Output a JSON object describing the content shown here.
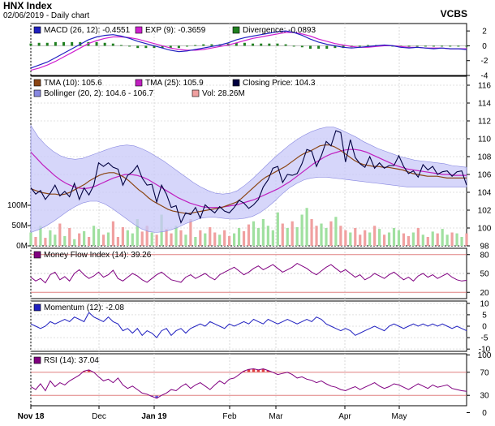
{
  "header": {
    "title": "HNX Index",
    "subtitle": "02/06/2019 - Daily chart",
    "brand": "VCBS"
  },
  "colors": {
    "panel_bg": "#ffffff",
    "band": "#c8c8f8",
    "band_edge": "#8888e0",
    "close": "#000040",
    "tma10": "#8b4513",
    "tma25": "#c020c0",
    "macd": "#2020c0",
    "signal": "#d020d0",
    "divergence": "#208020",
    "mfi": "#800080",
    "momentum": "#2020c0",
    "rsi": "#800080",
    "vol_up": "#a0e0a0",
    "vol_down": "#f0a0a0",
    "overbought": "#e04040",
    "oversold": "#6060e0"
  },
  "chart_data": {
    "type": "line",
    "x_axis": {
      "labels": [
        "Nov 18",
        "Dec",
        "Jan 19",
        "Feb",
        "Mar",
        "Apr",
        "May"
      ],
      "bold": [
        "Nov 18",
        "Jan 19"
      ]
    },
    "panels": [
      {
        "id": "macd",
        "legend": [
          {
            "label": "MACD (26, 12): -0.4551",
            "color": "#2020c0"
          },
          {
            "label": "EXP (9): -0.3659",
            "color": "#d020d0"
          },
          {
            "label": "Divergence: -0.0893",
            "color": "#208020"
          }
        ],
        "ylim": [
          -4,
          3
        ],
        "ticks": [
          "2",
          "0",
          "-2",
          "-4"
        ],
        "macd": [
          -3.0,
          -2.6,
          -2.2,
          -1.6,
          -1.0,
          -0.4,
          0.2,
          0.8,
          1.2,
          1.4,
          1.5,
          1.3,
          1.0,
          0.6,
          0.3,
          0.0,
          -0.3,
          -0.6,
          -0.8,
          -0.7,
          -0.5,
          -0.3,
          -0.1,
          0.1,
          0.4,
          0.8,
          1.1,
          1.3,
          1.5,
          1.7,
          1.9,
          2.0,
          1.8,
          1.4,
          0.9,
          0.5,
          0.2,
          0.0,
          -0.2,
          -0.3,
          -0.2,
          -0.1,
          0.0,
          0.1,
          0.0,
          -0.2,
          -0.3,
          -0.2,
          -0.3,
          -0.4,
          -0.3,
          -0.4,
          -0.4,
          -0.5
        ],
        "signal": [
          -3.3,
          -3.0,
          -2.6,
          -2.1,
          -1.5,
          -0.9,
          -0.3,
          0.3,
          0.7,
          1.0,
          1.2,
          1.2,
          1.1,
          0.9,
          0.6,
          0.3,
          0.0,
          -0.3,
          -0.5,
          -0.6,
          -0.6,
          -0.5,
          -0.3,
          -0.1,
          0.1,
          0.4,
          0.7,
          1.0,
          1.2,
          1.4,
          1.6,
          1.8,
          1.8,
          1.6,
          1.3,
          0.9,
          0.6,
          0.3,
          0.1,
          -0.1,
          -0.2,
          -0.2,
          -0.1,
          0.0,
          0.0,
          -0.1,
          -0.2,
          -0.2,
          -0.3,
          -0.3,
          -0.3,
          -0.4,
          -0.4,
          -0.4
        ],
        "divergence": [
          0.3,
          0.4,
          0.4,
          0.5,
          0.5,
          0.5,
          0.5,
          0.5,
          0.5,
          0.4,
          0.3,
          0.1,
          -0.1,
          -0.3,
          -0.3,
          -0.3,
          -0.3,
          -0.3,
          -0.3,
          -0.1,
          0.1,
          0.2,
          0.2,
          0.2,
          0.3,
          0.4,
          0.4,
          0.3,
          0.3,
          0.3,
          0.3,
          0.2,
          0.0,
          -0.2,
          -0.4,
          -0.4,
          -0.4,
          -0.3,
          -0.3,
          -0.2,
          0.0,
          0.1,
          0.1,
          0.1,
          0.0,
          -0.1,
          -0.1,
          0.0,
          0.0,
          -0.1,
          0.0,
          0.0,
          0.0,
          -0.1
        ]
      },
      {
        "id": "price",
        "legend": [
          {
            "label": "TMA (10): 105.6",
            "color": "#8b4513"
          },
          {
            "label": "TMA (25): 105.9",
            "color": "#c020c0"
          },
          {
            "label": "Closing Price: 104.3",
            "color": "#000040"
          },
          {
            "label": "Bollinger (20, 2): 104.6 - 106.7",
            "color": "#8888e0"
          },
          {
            "label": "Vol: 28.26M",
            "color": "#f0a0a0"
          }
        ],
        "ylim": [
          98,
          117
        ],
        "ticks": [
          "116",
          "114",
          "112",
          "110",
          "108",
          "106",
          "104",
          "102",
          "100",
          "98"
        ],
        "vol_ticks": [
          "100M",
          "50M",
          "0M"
        ],
        "vol_max": 200,
        "close": [
          104.5,
          103.8,
          104.2,
          103.2,
          103.9,
          104.8,
          103.6,
          104.1,
          103.5,
          105.0,
          103.2,
          104.5,
          103.7,
          104.8,
          107.3,
          106.9,
          107.3,
          106.8,
          106.6,
          104.8,
          105.9,
          106.3,
          107.0,
          105.6,
          104.8,
          104.9,
          102.9,
          104.8,
          103.8,
          102.3,
          102.5,
          100.6,
          101.7,
          101.5,
          102.3,
          101.1,
          102.6,
          102.1,
          101.7,
          102.4,
          101.9,
          101.7,
          102.3,
          103.1,
          102.8,
          102.2,
          102.6,
          103.2,
          104.6,
          105.4,
          106.7,
          106.9,
          105.1,
          106.0,
          105.9,
          106.1,
          107.2,
          108.8,
          108.6,
          106.9,
          108.1,
          109.7,
          109.2,
          110.9,
          110.7,
          107.4,
          109.9,
          107.9,
          107.2,
          106.8,
          108.0,
          106.7,
          107.3,
          106.7,
          107.0,
          107.0,
          108.1,
          106.9,
          106.1,
          106.4,
          105.7,
          107.1,
          106.5,
          106.9,
          106.0,
          106.3,
          106.4,
          105.8,
          106.3,
          106.4,
          104.8
        ],
        "tma10": [
          104.4,
          104.2,
          104.0,
          103.9,
          103.8,
          103.8,
          103.7,
          103.8,
          104.0,
          104.3,
          104.6,
          104.9,
          105.3,
          105.6,
          105.9,
          106.1,
          106.2,
          106.2,
          106.0,
          105.7,
          105.3,
          104.8,
          104.3,
          103.9,
          103.4,
          103.0,
          102.7,
          102.4,
          102.1,
          101.9,
          101.8,
          101.7,
          101.6,
          101.7,
          101.8,
          101.9,
          102.0,
          102.1,
          102.2,
          102.3,
          102.5,
          102.7,
          102.9,
          103.3,
          103.8,
          104.3,
          104.8,
          105.3,
          105.7,
          106.0,
          106.3,
          106.6,
          106.9,
          107.3,
          107.7,
          108.1,
          108.4,
          108.6,
          108.9,
          109.2,
          109.3,
          109.3,
          109.1,
          108.8,
          108.4,
          108.0,
          107.6,
          107.3,
          107.1,
          107.0,
          106.9,
          106.9,
          106.8,
          106.8,
          106.7,
          106.6,
          106.5,
          106.3,
          106.1,
          106.0,
          105.9,
          105.8,
          105.8,
          105.8,
          105.7,
          105.6,
          105.6,
          105.6,
          105.6,
          105.6
        ],
        "tma25": [
          108.5,
          107.8,
          107.1,
          106.5,
          105.9,
          105.4,
          105.0,
          104.7,
          104.5,
          104.4,
          104.5,
          104.7,
          105.0,
          105.3,
          105.6,
          105.8,
          106.0,
          106.0,
          105.9,
          105.7,
          105.4,
          105.0,
          104.6,
          104.2,
          103.8,
          103.4,
          103.1,
          102.8,
          102.6,
          102.4,
          102.3,
          102.3,
          102.3,
          102.4,
          102.5,
          102.6,
          102.8,
          103.0,
          103.2,
          103.5,
          103.8,
          104.1,
          104.4,
          104.8,
          105.2,
          105.7,
          106.2,
          106.7,
          107.2,
          107.6,
          108.0,
          108.3,
          108.5,
          108.7,
          108.8,
          108.8,
          108.7,
          108.5,
          108.2,
          107.9,
          107.6,
          107.3,
          107.0,
          106.8,
          106.6,
          106.5,
          106.4,
          106.3,
          106.2,
          106.1,
          106.0,
          106.0,
          105.9,
          105.9,
          105.9
        ],
        "boll_upper": [
          111.5,
          110.2,
          109.3,
          108.6,
          108.1,
          107.8,
          107.7,
          107.8,
          108.1,
          108.4,
          108.7,
          109.0,
          109.2,
          109.3,
          109.2,
          108.9,
          108.5,
          108.0,
          107.5,
          106.9,
          106.3,
          105.7,
          105.1,
          104.6,
          104.2,
          103.9,
          103.8,
          103.9,
          104.2,
          104.8,
          105.5,
          106.3,
          107.1,
          107.9,
          108.6,
          109.3,
          109.9,
          110.4,
          110.8,
          111.1,
          111.3,
          111.3,
          111.0,
          110.6,
          110.2,
          109.7,
          109.3,
          108.9,
          108.6,
          108.3,
          108.0,
          107.8,
          107.6,
          107.5,
          107.4,
          107.3,
          107.2,
          107.0,
          106.9,
          106.8
        ],
        "boll_lower": [
          99.5,
          99.8,
          100.2,
          100.7,
          101.3,
          101.9,
          102.4,
          102.8,
          103.0,
          103.0,
          102.7,
          102.2,
          101.6,
          101.0,
          100.4,
          99.9,
          99.6,
          99.5,
          99.6,
          99.8,
          100.1,
          100.5,
          100.8,
          101.1,
          101.2,
          101.2,
          101.1,
          101.0,
          101.0,
          101.1,
          101.3,
          101.7,
          102.3,
          103.0,
          103.8,
          104.5,
          105.0,
          105.4,
          105.6,
          105.7,
          105.7,
          105.6,
          105.5,
          105.4,
          105.3,
          105.2,
          105.1,
          105.0,
          104.9,
          104.8,
          104.7,
          104.6,
          104.6,
          104.6,
          104.6,
          104.6,
          104.6,
          104.6,
          104.6,
          104.6
        ],
        "volume": [
          30,
          20,
          45,
          18,
          35,
          25,
          50,
          22,
          40,
          15,
          28,
          33,
          20,
          45,
          38,
          25,
          30,
          55,
          20,
          42,
          35,
          28,
          60,
          32,
          45,
          30,
          25,
          70,
          38,
          28,
          45,
          35,
          25,
          60,
          20,
          35,
          28,
          42,
          30,
          25,
          35,
          22,
          28,
          40,
          33,
          48,
          55,
          40,
          60,
          45,
          35,
          75,
          50,
          40,
          55,
          42,
          70,
          85,
          60,
          45,
          50,
          40,
          55,
          65,
          45,
          35,
          30,
          40,
          25,
          35,
          30,
          45,
          38,
          25,
          30,
          40,
          35,
          28,
          22,
          30,
          40,
          25,
          20,
          32,
          28,
          38,
          25,
          30,
          28,
          20,
          28
        ],
        "volume_up": [
          1,
          0,
          1,
          0,
          1,
          1,
          0,
          1,
          0,
          1,
          0,
          1,
          0,
          1,
          1,
          0,
          1,
          0,
          0,
          0,
          1,
          1,
          1,
          0,
          0,
          1,
          0,
          1,
          0,
          0,
          1,
          0,
          1,
          0,
          1,
          0,
          1,
          0,
          0,
          1,
          0,
          0,
          1,
          1,
          0,
          0,
          1,
          1,
          1,
          1,
          1,
          1,
          0,
          1,
          0,
          1,
          1,
          1,
          0,
          0,
          1,
          1,
          0,
          1,
          0,
          0,
          1,
          0,
          0,
          0,
          1,
          0,
          1,
          0,
          1,
          1,
          1,
          0,
          0,
          1,
          0,
          1,
          0,
          1,
          0,
          1,
          1,
          0,
          1,
          1,
          0
        ]
      },
      {
        "id": "mfi",
        "legend": [
          {
            "label": "Money Flow Index (14): 39.26",
            "color": "#800080"
          }
        ],
        "ylim": [
          10,
          90
        ],
        "ticks": [
          "80",
          "50",
          "20"
        ],
        "values": [
          44,
          38,
          42,
          35,
          48,
          52,
          40,
          45,
          38,
          50,
          56,
          48,
          42,
          46,
          52,
          44,
          48,
          55,
          42,
          38,
          44,
          50,
          46,
          40,
          36,
          42,
          48,
          52,
          46,
          40,
          38,
          36,
          44,
          48,
          42,
          46,
          50,
          44,
          40,
          48,
          52,
          56,
          60,
          54,
          48,
          52,
          58,
          62,
          56,
          60,
          64,
          58,
          52,
          56,
          60,
          66,
          62,
          58,
          52,
          48,
          54,
          60,
          64,
          58,
          52,
          56,
          50,
          44,
          48,
          40,
          44,
          50,
          46,
          42,
          48,
          52,
          46,
          40,
          44,
          38,
          46,
          50,
          44,
          48,
          42,
          46,
          50,
          44,
          40,
          38,
          39
        ]
      },
      {
        "id": "momentum",
        "legend": [
          {
            "label": "Momentum (12): -2.08",
            "color": "#2020c0"
          }
        ],
        "ylim": [
          -11,
          11
        ],
        "ticks": [
          "10",
          "5",
          "0",
          "-5",
          "-10"
        ],
        "values": [
          1,
          0,
          -1,
          0,
          2,
          1,
          2,
          3,
          2,
          4,
          3,
          2,
          6,
          4,
          3,
          2,
          4,
          2,
          1,
          -2,
          -1,
          -3,
          -1,
          -4,
          -2,
          -3,
          -5,
          -2,
          -1,
          -4,
          -2,
          -1,
          -3,
          -1,
          0,
          1,
          0,
          2,
          1,
          0,
          -1,
          1,
          0,
          1,
          2,
          1,
          3,
          2,
          1,
          3,
          2,
          1,
          2,
          3,
          2,
          1,
          2,
          3,
          2,
          4,
          3,
          1,
          0,
          -1,
          -2,
          -1,
          -2,
          -4,
          -3,
          -2,
          -1,
          0,
          -1,
          -2,
          0,
          1,
          0,
          -1,
          0,
          1,
          0,
          1,
          0,
          1,
          0,
          1,
          0,
          -1,
          0,
          -1,
          -2
        ]
      },
      {
        "id": "rsi",
        "legend": [
          {
            "label": "RSI (14): 37.04",
            "color": "#800080"
          }
        ],
        "ylim": [
          12,
          102
        ],
        "ticks": [
          "100",
          "70",
          "30",
          "0"
        ],
        "overbought": 70,
        "oversold": 30,
        "values": [
          45,
          40,
          50,
          38,
          55,
          45,
          52,
          48,
          55,
          60,
          65,
          72,
          74,
          70,
          62,
          55,
          58,
          52,
          60,
          48,
          42,
          46,
          40,
          34,
          32,
          28,
          25,
          30,
          34,
          40,
          38,
          45,
          50,
          42,
          48,
          52,
          46,
          40,
          48,
          55,
          50,
          58,
          60,
          66,
          72,
          75,
          76,
          74,
          76,
          73,
          70,
          66,
          68,
          70,
          66,
          60,
          62,
          58,
          56,
          52,
          55,
          50,
          46,
          44,
          40,
          38,
          42,
          45,
          40,
          44,
          48,
          52,
          46,
          42,
          45,
          50,
          48,
          44,
          40,
          45,
          50,
          46,
          42,
          48,
          44,
          46,
          48,
          42,
          40,
          38,
          37
        ]
      }
    ]
  }
}
